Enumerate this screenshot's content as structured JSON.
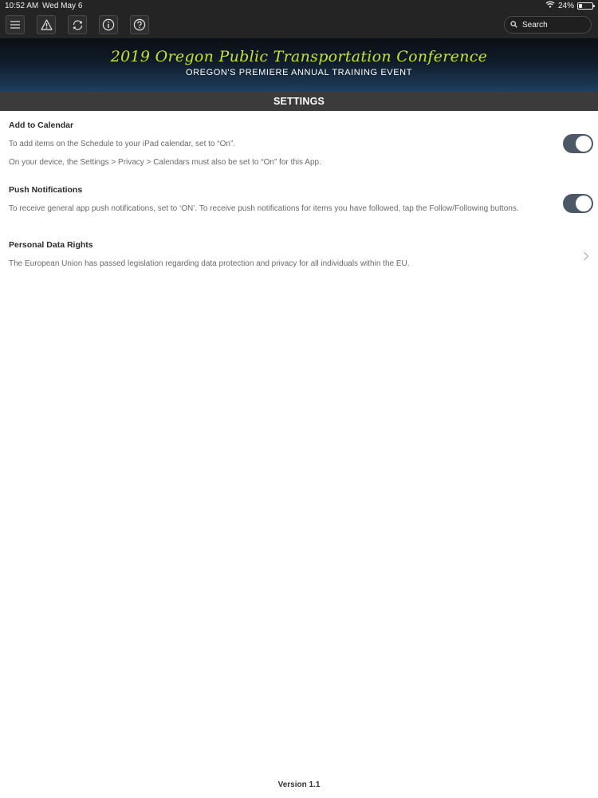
{
  "status_bar": {
    "time": "10:52 AM",
    "date": "Wed May 6",
    "battery_percent": "24%",
    "battery_level": 0.24,
    "wifi_icon": "wifi-icon"
  },
  "toolbar": {
    "icons": [
      "menu-icon",
      "alert-icon",
      "refresh-icon",
      "info-icon",
      "help-icon"
    ],
    "search_label": "Search"
  },
  "banner": {
    "title": "2019 Oregon Public Transportation Conference",
    "subtitle": "OREGON'S PREMIERE ANNUAL TRAINING EVENT"
  },
  "settings": {
    "header": "SETTINGS",
    "calendar": {
      "title": "Add to Calendar",
      "line1": "To add items on the Schedule to your iPad calendar, set to “On”.",
      "line2": "On your device, the Settings > Privacy > Calendars must also be set to “On” for this App.",
      "enabled": true
    },
    "push": {
      "title": "Push Notifications",
      "line1": "To receive general app push notifications, set to ‘ON’. To receive push notifications for items you have followed, tap the Follow/Following buttons.",
      "enabled": true
    },
    "privacy": {
      "title": "Personal Data Rights",
      "line1": "The European Union has passed legislation regarding data protection and privacy for all individuals within the EU."
    }
  },
  "footer": {
    "version": "Version 1.1"
  },
  "colors": {
    "toolbar_bg": "#242424",
    "banner_title": "#c6e03a",
    "settings_header_bg": "#3b3b3b",
    "toggle_on": "#4d5866"
  }
}
